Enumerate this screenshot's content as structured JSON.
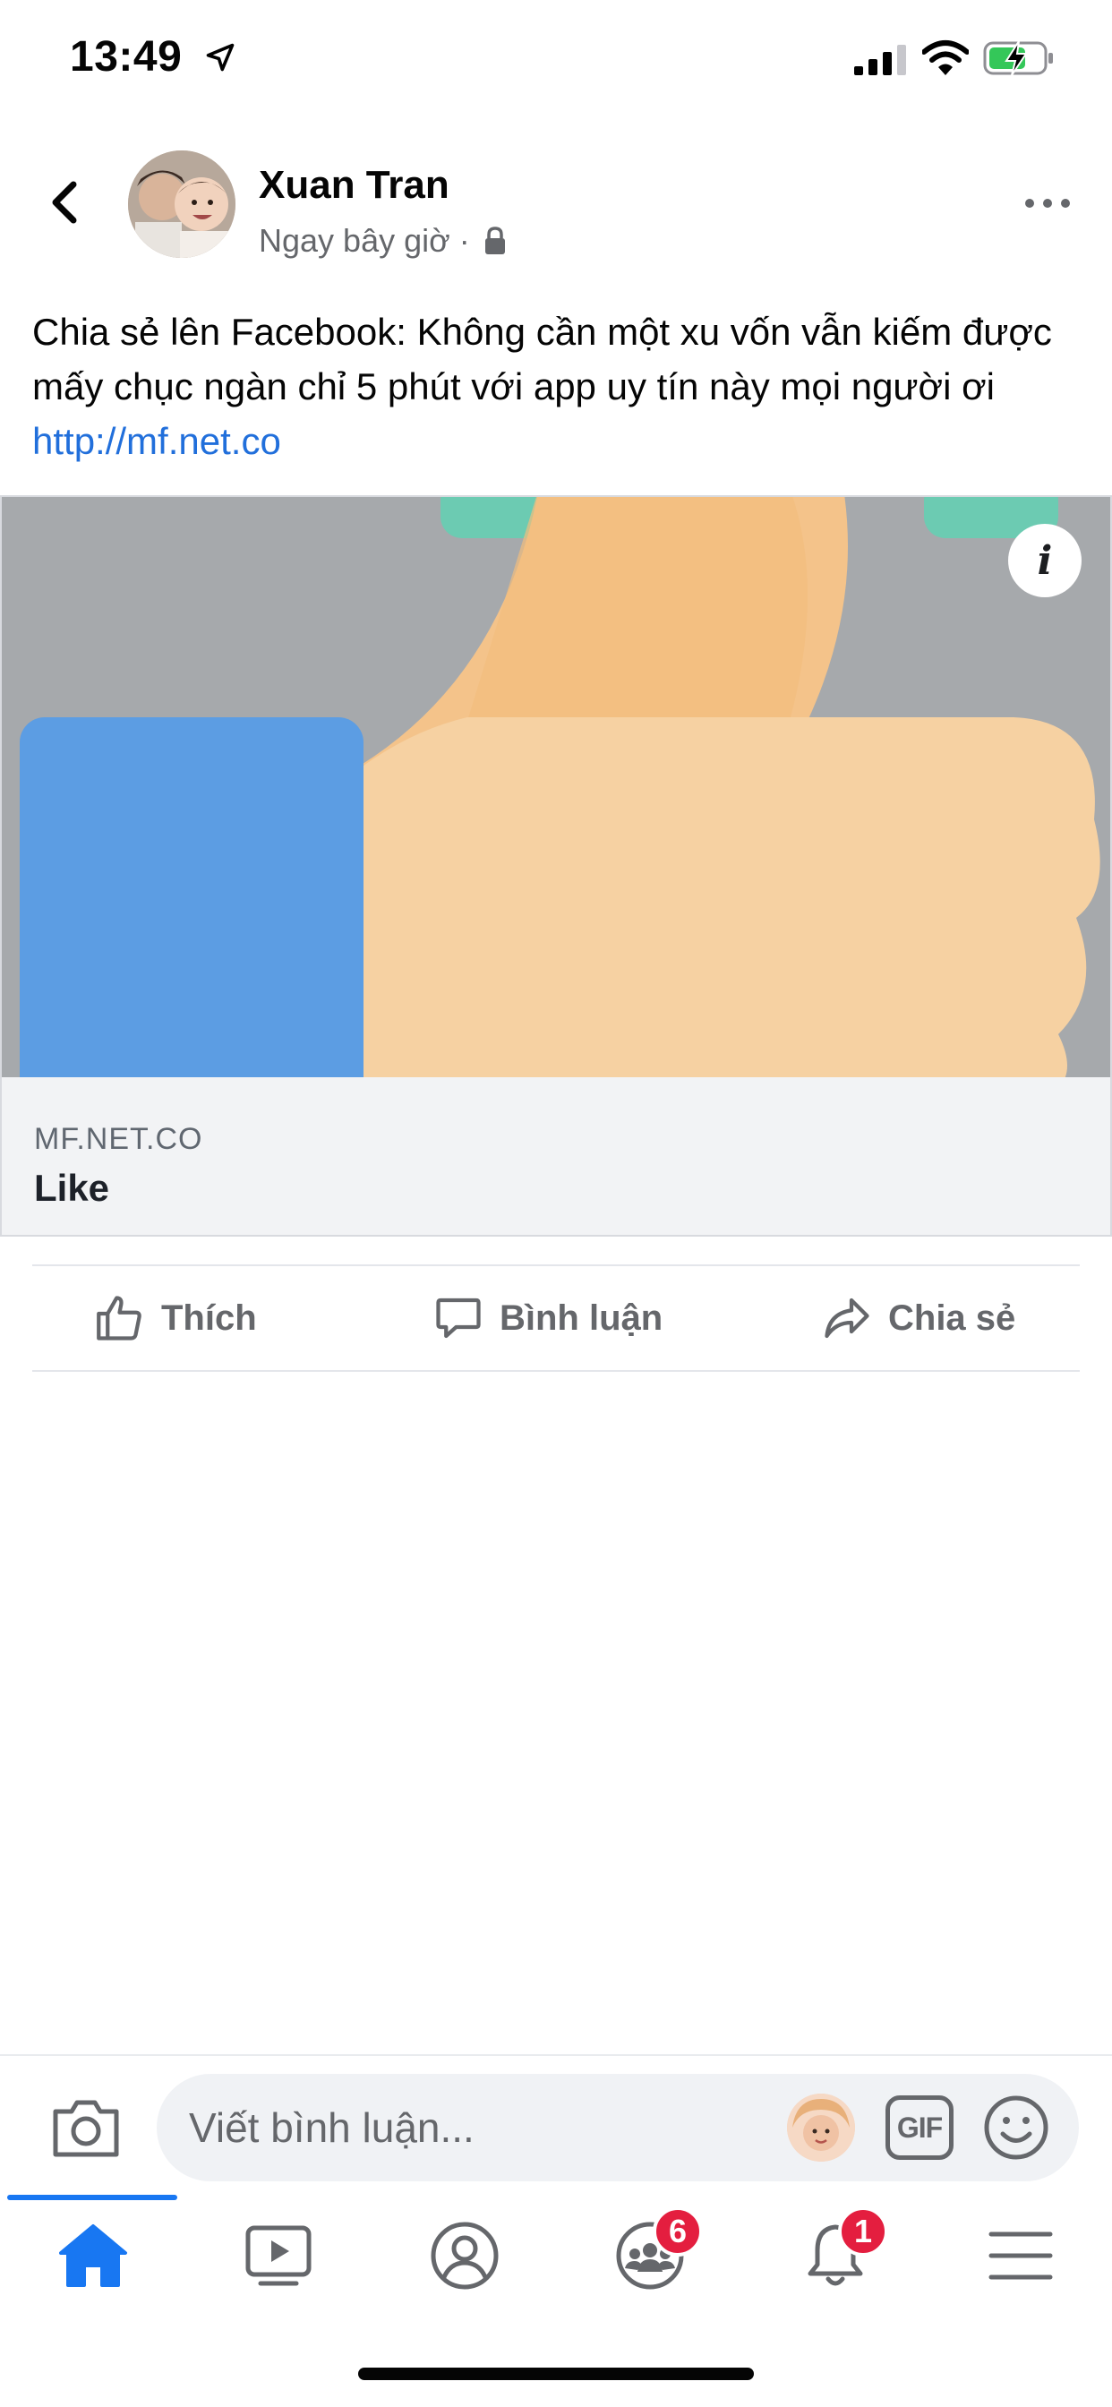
{
  "status_bar": {
    "time": "13:49",
    "icons": [
      "location-arrow-icon",
      "cellular-signal-icon",
      "wifi-icon",
      "battery-charging-icon"
    ]
  },
  "post": {
    "author": "Xuan Tran",
    "timestamp": "Ngay bây giờ ·",
    "privacy_icon": "lock-icon",
    "text": "Chia sẻ lên Facebook: Không cần một xu vốn vẫn kiếm được mấy chục ngàn chỉ 5 phút với app uy tín này mọi người ơi ",
    "link": "http://mf.net.co"
  },
  "link_preview": {
    "info_label": "i",
    "domain": "MF.NET.CO",
    "title": "Like"
  },
  "actions": {
    "like": "Thích",
    "comment": "Bình luận",
    "share": "Chia sẻ"
  },
  "composer": {
    "placeholder": "Viết bình luận...",
    "gif_label": "GIF"
  },
  "tab_bar": {
    "active_tab": "home",
    "groups_badge": "6",
    "notifications_badge": "1"
  },
  "colors": {
    "accent": "#1877f2",
    "link": "#216fdb",
    "badge": "#e41e3f",
    "secondary_text": "#65676b"
  }
}
